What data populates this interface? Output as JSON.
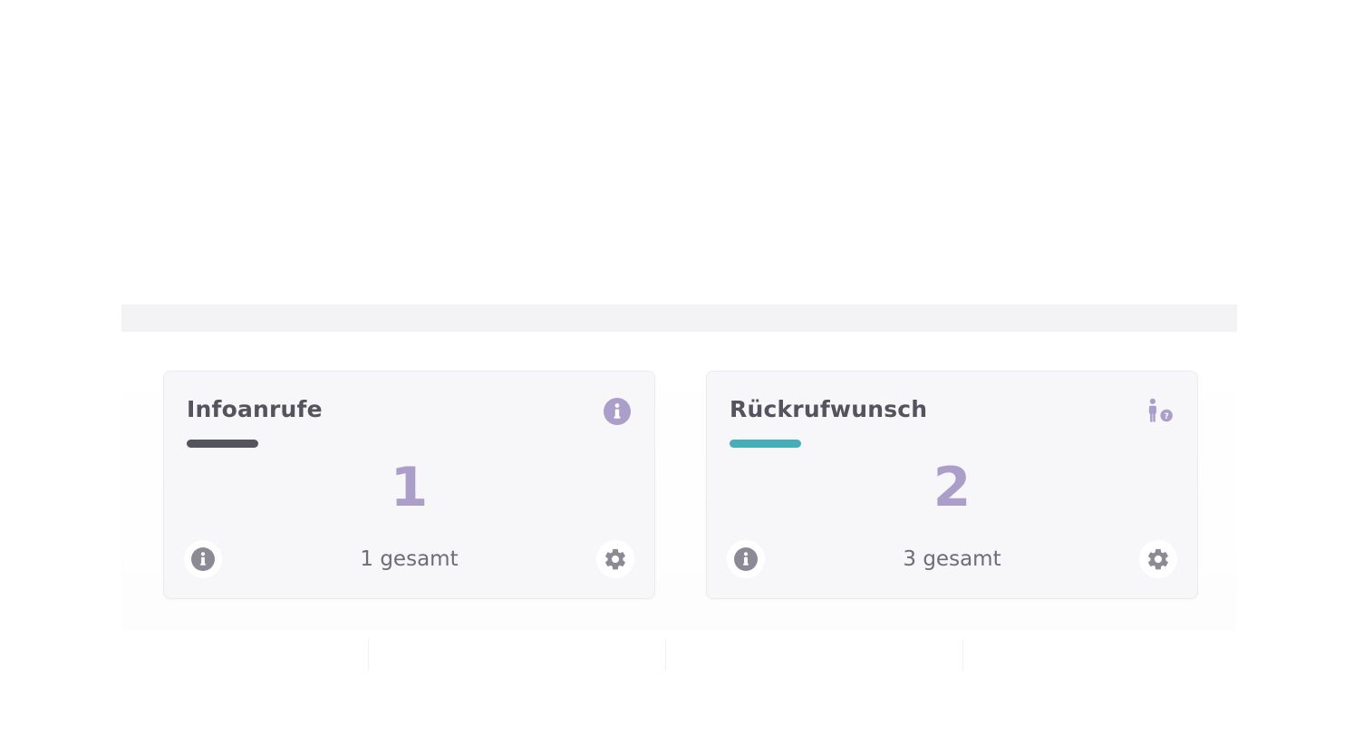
{
  "cards": [
    {
      "title": "Infoanrufe",
      "count": "1",
      "total_label": "1 gesamt",
      "accent_color": "#535460",
      "corner_icon": "info-icon",
      "footer_left_icon": "info-icon",
      "footer_right_icon": "gear-icon"
    },
    {
      "title": "Rückrufwunsch",
      "count": "2",
      "total_label": "3 gesamt",
      "accent_color": "#45aeb7",
      "corner_icon": "person-question-icon",
      "footer_left_icon": "info-icon",
      "footer_right_icon": "gear-icon"
    }
  ],
  "colors": {
    "count": "#ab9ec9",
    "icon_purple": "#ab9ec9",
    "icon_gray": "#8c8a94"
  }
}
